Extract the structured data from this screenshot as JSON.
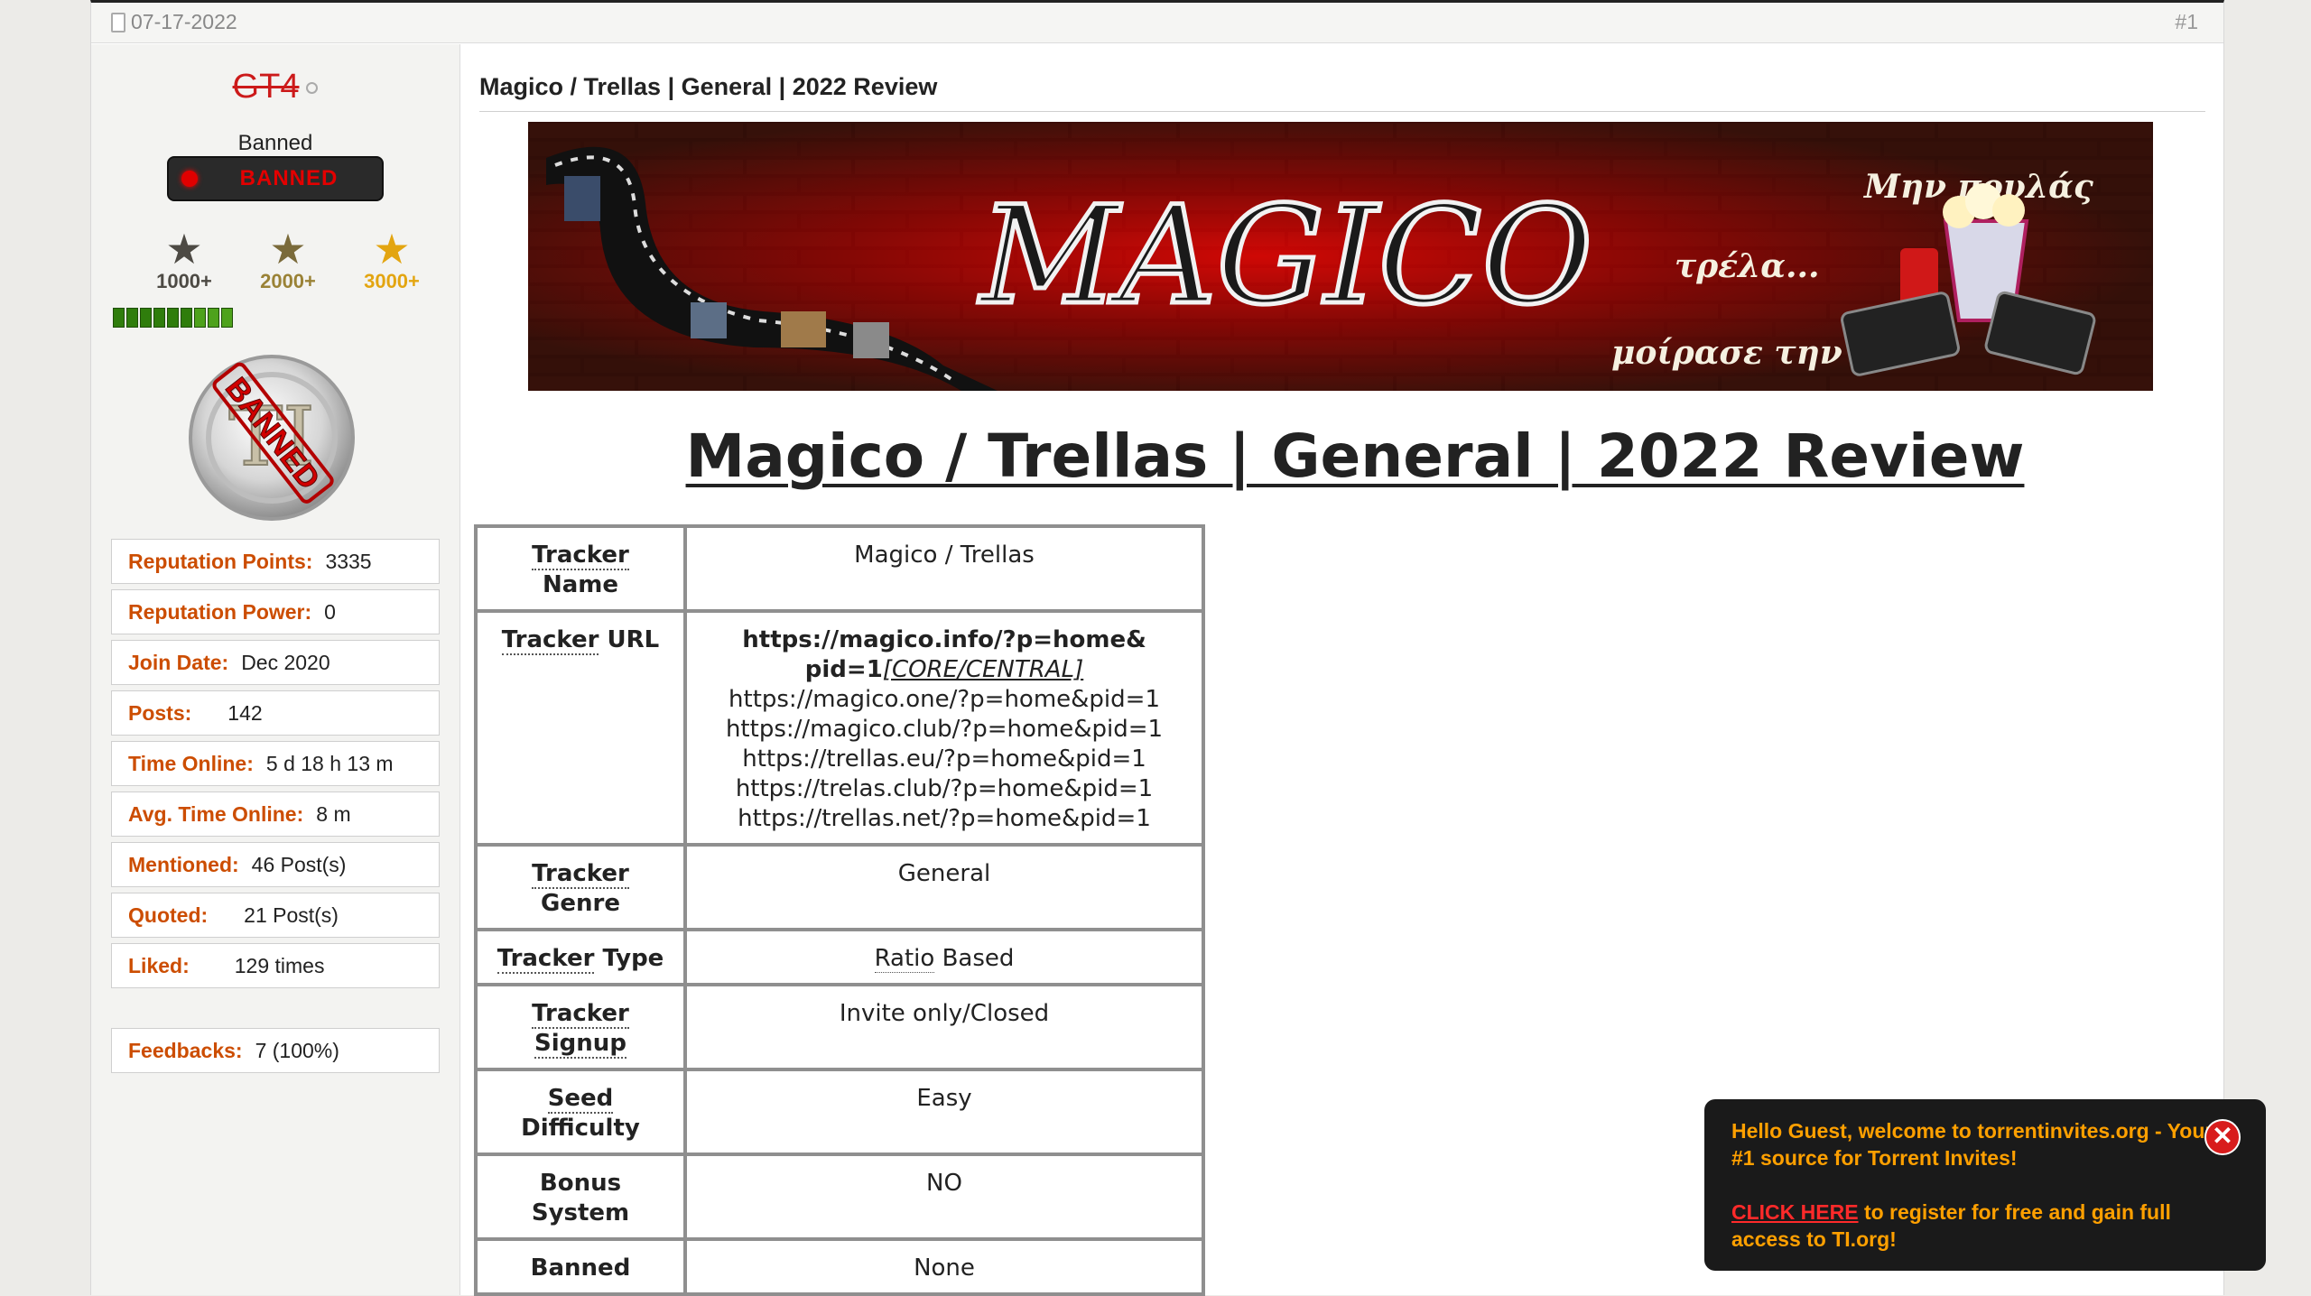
{
  "post": {
    "date": "07-17-2022",
    "number": "#1",
    "title": "Magico / Trellas | General | 2022 Review"
  },
  "user": {
    "name": "GT4",
    "title": "Banned",
    "badge": "BANNED",
    "awards": [
      "1000+",
      "2000+",
      "3000+"
    ],
    "avatar_stamp": "BANNED",
    "avatar_letters": "TI",
    "stats": [
      {
        "label": "Reputation Points:",
        "value": "3335"
      },
      {
        "label": "Reputation Power:",
        "value": "0"
      },
      {
        "label": "Join Date:",
        "value": "Dec 2020"
      },
      {
        "label": "Posts:",
        "value": "142"
      },
      {
        "label": "Time Online:",
        "value": "5 d 18 h 13 m"
      },
      {
        "label": "Avg. Time Online:",
        "value": "8 m"
      },
      {
        "label": "Mentioned:",
        "value": "46 Post(s)"
      },
      {
        "label": "Quoted:",
        "value": "21 Post(s)"
      },
      {
        "label": "Liked:",
        "value": "129 times"
      }
    ],
    "feedback": {
      "label": "Feedbacks:",
      "value": "7 (100%)"
    }
  },
  "banner": {
    "logo_text": "MAGICO",
    "slogan_1": "Μην πουλάς",
    "slogan_2": "τρέλα...",
    "slogan_3": "μοίρασε την"
  },
  "review": {
    "heading": "Magico / Trellas | General | 2022 Review",
    "rows": {
      "name": {
        "k1": "Tracker",
        "k2": "Name",
        "value": "Magico / Trellas"
      },
      "url": {
        "k1": "Tracker",
        "k2": "URL",
        "primary_1": "https://magico.info/?p=home&",
        "primary_2": "pid=1",
        "primary_tag": "[CORE/CENTRAL]",
        "others": [
          "https://magico.one/?p=home&pid=1",
          "https://magico.club/?p=home&pid=1",
          "https://trellas.eu/?p=home&pid=1",
          "https://trelas.club/?p=home&pid=1",
          "https://trellas.net/?p=home&pid=1"
        ]
      },
      "genre": {
        "k1": "Tracker",
        "k2": "Genre",
        "value": "General"
      },
      "type": {
        "k1": "Tracker",
        "k2": "Type",
        "v1": "Ratio",
        "v2": "Based"
      },
      "signup": {
        "k1": "Tracker",
        "k2": "Signup",
        "value": "Invite only/Closed"
      },
      "seed": {
        "k1": "Seed",
        "k2": "Difficulty",
        "value": "Easy"
      },
      "bonus": {
        "k1": "Bonus",
        "k2": "System",
        "value": "NO"
      },
      "banned": {
        "k1": "Banned",
        "value": "None"
      }
    }
  },
  "popup": {
    "welcome": "Hello Guest, welcome to torrentinvites.org - Your #1 source for Torrent Invites!",
    "link_text": "CLICK HERE",
    "link_rest": " to register for free and gain full access to TI.org!",
    "close_glyph": "✕"
  },
  "colors": {
    "stat_label": "#cc4d00",
    "username": "#cc1a1a",
    "popup_text": "#ffa000",
    "popup_bg": "#1a1a1a",
    "rep_bar": "#2f7d0c"
  },
  "icons": [
    "document-icon",
    "offline-status-icon",
    "star-icon",
    "close-icon"
  ]
}
